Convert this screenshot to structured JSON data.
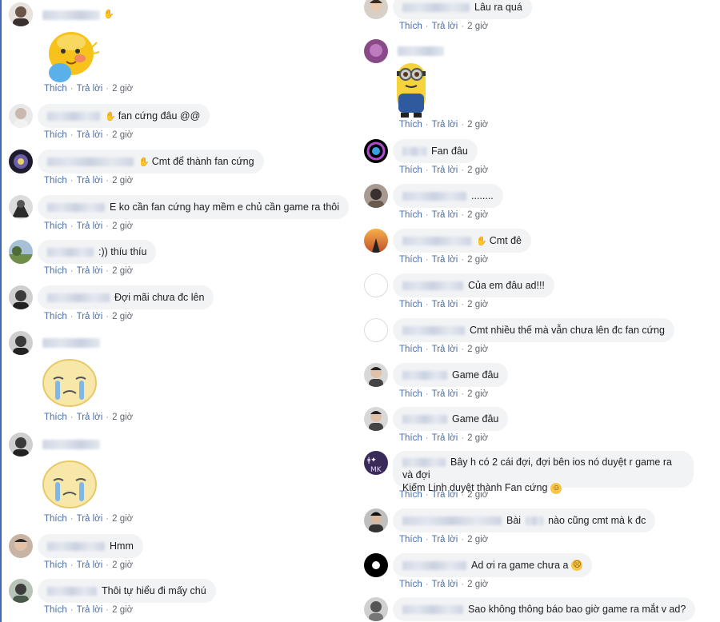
{
  "actions": {
    "like": "Thích",
    "reply": "Trả lời",
    "sep": "·"
  },
  "colors": {
    "bubble": "#f2f3f5",
    "link": "#4a6ea9",
    "meta": "#606770"
  },
  "left_comments": [
    {
      "text": "",
      "time": "2 giờ",
      "sticker": "yellow-crying-sticker"
    },
    {
      "text": "fan cứng đâu @@",
      "time": "2 giờ"
    },
    {
      "text": "Cmt để thành fan cứng",
      "time": "2 giờ"
    },
    {
      "text": "E ko cần fan cứng hay mềm e chủ cần game ra thôi",
      "time": "2 giờ"
    },
    {
      "text": ":)) thíu thíu",
      "time": "2 giờ"
    },
    {
      "text": "Đợi mãi chưa đc lên",
      "time": "2 giờ"
    },
    {
      "text": "",
      "time": "2 giờ",
      "sticker": "crying-face-sticker"
    },
    {
      "text": "",
      "time": "2 giờ",
      "sticker": "crying-face-sticker"
    },
    {
      "text": "Hmm",
      "time": "2 giờ"
    },
    {
      "text": "Thôi tự hiểu đi mấy chú",
      "time": "2 giờ"
    }
  ],
  "right_comments": [
    {
      "text": "Lâu ra quá",
      "time": "2 giờ"
    },
    {
      "text": "",
      "time": "2 giờ",
      "sticker": "minion-sticker"
    },
    {
      "text": "Fan đâu",
      "time": "2 giờ"
    },
    {
      "text": "........",
      "time": "2 giờ"
    },
    {
      "text": "Cmt đê",
      "time": "2 giờ"
    },
    {
      "text": "Của em đâu ad!!!",
      "time": "2 giờ"
    },
    {
      "text": "Cmt nhiều thế mà vẫn chưa lên đc fan cứng",
      "time": "2 giờ"
    },
    {
      "text": "Game đâu",
      "time": "2 giờ"
    },
    {
      "text": "Game đâu",
      "time": "2 giờ"
    },
    {
      "text": "Bây h có 2 cái đợi, đợi bên ios nó duyệt r game ra và đợi",
      "text2": "Kiếm Linh duyệt thành Fan cứng",
      "time": "2 giờ"
    },
    {
      "text": "Bài",
      "text2": "nào cũng cmt mà k đc",
      "time": "2 giờ"
    },
    {
      "text": "Ad ơi ra game chưa a",
      "time": "2 giờ"
    },
    {
      "text": "Sao không thông báo bao giờ game ra mắt v ad?",
      "time": ""
    }
  ]
}
